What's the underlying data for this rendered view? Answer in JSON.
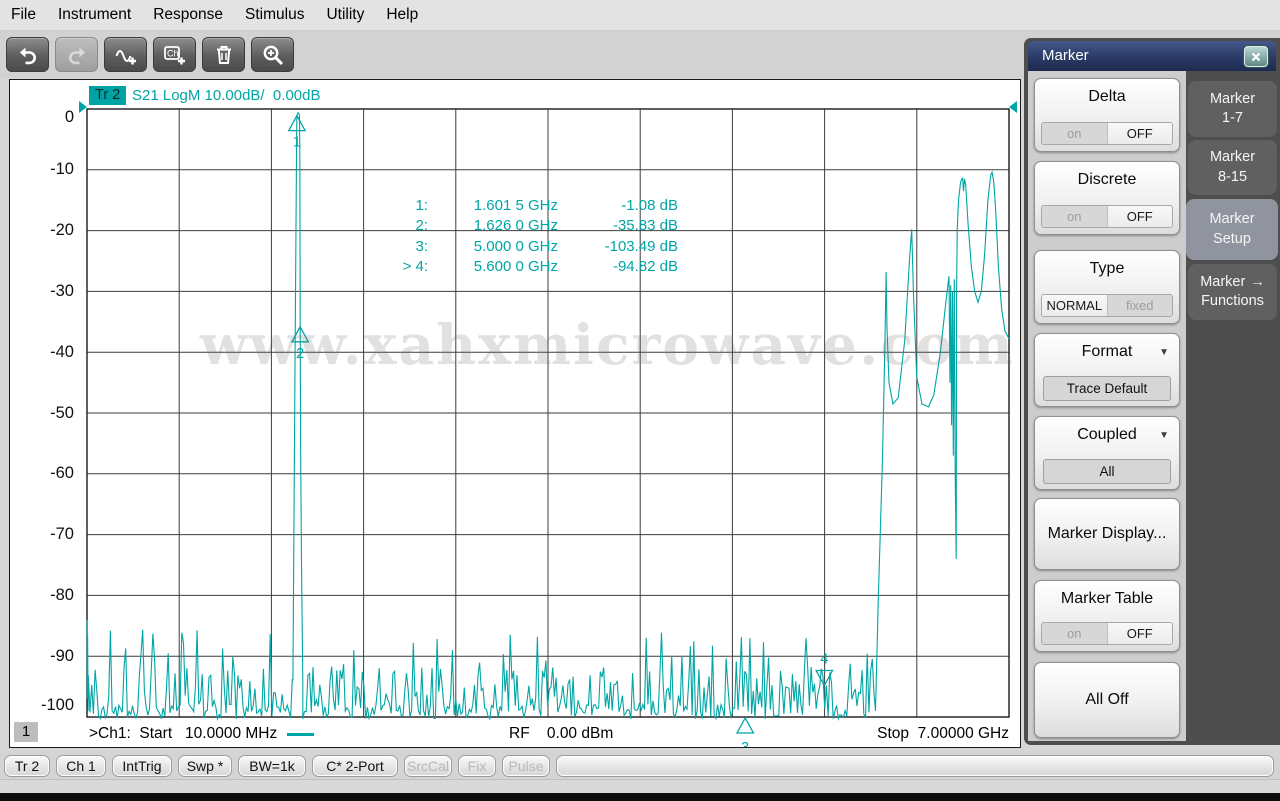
{
  "menu": {
    "items": [
      "File",
      "Instrument",
      "Response",
      "Stimulus",
      "Utility",
      "Help"
    ]
  },
  "toolbar": {
    "buttons": [
      {
        "name": "undo",
        "enabled": true
      },
      {
        "name": "redo",
        "enabled": false
      },
      {
        "name": "add-trace",
        "enabled": true
      },
      {
        "name": "add-channel",
        "enabled": true
      },
      {
        "name": "delete",
        "enabled": true
      },
      {
        "name": "zoom",
        "enabled": true
      }
    ]
  },
  "chart": {
    "trace_badge": "Tr 2",
    "trace_label": "S21 LogM 10.00dB/  0.00dB",
    "y_ticks": [
      "0",
      "-10",
      "-20",
      "-30",
      "-40",
      "-50",
      "-60",
      "-70",
      "-80",
      "-90",
      "-100"
    ],
    "markers_readout": [
      {
        "label": "1:",
        "freq": "1.601 5 GHz",
        "value": "-1.08 dB"
      },
      {
        "label": "2:",
        "freq": "1.626 0 GHz",
        "value": "-35.83 dB"
      },
      {
        "label": "3:",
        "freq": "5.000 0 GHz",
        "value": "-103.49 dB"
      },
      {
        "label": "> 4:",
        "freq": "5.600 0 GHz",
        "value": "-94.82 dB"
      }
    ],
    "footer": {
      "channel": "1",
      "start": ">Ch1:  Start   10.0000 MHz",
      "rf": "RF    0.00 dBm",
      "stop": "Stop  7.00000 GHz"
    },
    "watermark": "www.xahxmicrowave.com"
  },
  "chart_data": {
    "type": "line",
    "title": "S21 LogM 10.00dB/ 0.00dB",
    "x_unit": "GHz",
    "y_unit": "dB",
    "x_range": [
      0.01,
      7.0
    ],
    "y_range": [
      -100,
      0
    ],
    "y_per_div": 10,
    "grid_divisions": [
      10,
      10
    ],
    "markers": [
      {
        "n": 1,
        "ghz": 1.6015,
        "db": -1.08,
        "flip": false
      },
      {
        "n": 2,
        "ghz": 1.626,
        "db": -35.83,
        "flip": false
      },
      {
        "n": 3,
        "ghz": 5.0,
        "db": -103.49,
        "flip": false
      },
      {
        "n": 4,
        "ghz": 5.6,
        "db": -94.82,
        "flip": true,
        "selected": true
      }
    ],
    "anchors_left_edge": [
      [
        0.01,
        -84
      ],
      [
        0.012,
        -97
      ],
      [
        0.0145,
        -86.5
      ],
      [
        0.018,
        -99
      ]
    ],
    "anchors_spur": [
      [
        1.571,
        -94
      ],
      [
        1.5875,
        -40
      ],
      [
        1.5995,
        -3
      ],
      [
        1.6015,
        -1.08
      ],
      [
        1.61,
        -0.6
      ],
      [
        1.62,
        -0.9
      ],
      [
        1.6235,
        -6
      ],
      [
        1.626,
        -35.83
      ],
      [
        1.6295,
        -55
      ],
      [
        1.636,
        -75
      ],
      [
        1.646,
        -94
      ]
    ],
    "anchors_passband": [
      [
        5.988,
        -99
      ],
      [
        6.01,
        -80
      ],
      [
        6.04,
        -58
      ],
      [
        6.06,
        -38
      ],
      [
        6.068,
        -26.8
      ],
      [
        6.075,
        -36
      ],
      [
        6.09,
        -45
      ],
      [
        6.12,
        -48.5
      ],
      [
        6.16,
        -47.5
      ],
      [
        6.21,
        -38
      ],
      [
        6.245,
        -25
      ],
      [
        6.262,
        -19.8
      ],
      [
        6.275,
        -30
      ],
      [
        6.3,
        -44
      ],
      [
        6.34,
        -48.5
      ],
      [
        6.39,
        -49
      ],
      [
        6.43,
        -47
      ],
      [
        6.48,
        -40
      ],
      [
        6.52,
        -32
      ],
      [
        6.545,
        -27.5
      ],
      [
        6.553,
        -45
      ],
      [
        6.558,
        -29
      ],
      [
        6.565,
        -52
      ],
      [
        6.572,
        -30
      ],
      [
        6.578,
        -57
      ],
      [
        6.585,
        -28
      ],
      [
        6.592,
        -60
      ],
      [
        6.6,
        -74
      ],
      [
        6.603,
        -30
      ],
      [
        6.607,
        -20
      ],
      [
        6.617,
        -15
      ],
      [
        6.633,
        -12
      ],
      [
        6.648,
        -11.3
      ],
      [
        6.655,
        -13.5
      ],
      [
        6.663,
        -11.5
      ],
      [
        6.672,
        -12.5
      ],
      [
        6.69,
        -19
      ],
      [
        6.715,
        -26
      ],
      [
        6.74,
        -30
      ],
      [
        6.765,
        -31.8
      ],
      [
        6.79,
        -30
      ],
      [
        6.815,
        -24
      ],
      [
        6.84,
        -15
      ],
      [
        6.862,
        -10.8
      ],
      [
        6.872,
        -10.4
      ],
      [
        6.885,
        -12
      ],
      [
        6.9,
        -17
      ],
      [
        6.92,
        -26
      ],
      [
        6.945,
        -33
      ],
      [
        6.97,
        -36.5
      ],
      [
        7.0,
        -37.8
      ]
    ],
    "noise_floor": {
      "base_db": -100,
      "spike_max_db": -85,
      "regions_ghz": [
        [
          0.02,
          1.571
        ],
        [
          1.646,
          5.988
        ]
      ]
    }
  },
  "panel": {
    "title": "Marker",
    "buttons": [
      {
        "id": "delta",
        "label": "Delta",
        "toggle": {
          "options": [
            "on",
            "OFF"
          ],
          "selected": 1
        }
      },
      {
        "id": "discrete",
        "label": "Discrete",
        "toggle": {
          "options": [
            "on",
            "OFF"
          ],
          "selected": 1
        }
      },
      {
        "id": "type",
        "label": "Type",
        "toggle": {
          "options": [
            "NORMAL",
            "fixed"
          ],
          "selected": 0
        }
      },
      {
        "id": "format",
        "label": "Format",
        "dropdown": true,
        "sub_label": "Trace Default"
      },
      {
        "id": "coupled",
        "label": "Coupled",
        "dropdown": true,
        "sub_label": "All"
      },
      {
        "id": "marker-display",
        "label": "Marker Display..."
      },
      {
        "id": "marker-table",
        "label": "Marker Table",
        "toggle": {
          "options": [
            "on",
            "OFF"
          ],
          "selected": 1
        }
      },
      {
        "id": "all-off",
        "label": "All Off"
      }
    ],
    "tabs": [
      {
        "id": "marker-1-7",
        "lines": [
          "Marker",
          "1-7"
        ],
        "selected": false,
        "arrow": false
      },
      {
        "id": "marker-8-15",
        "lines": [
          "Marker",
          "8-15"
        ],
        "selected": false,
        "arrow": false
      },
      {
        "id": "marker-setup",
        "lines": [
          "Marker",
          "Setup"
        ],
        "selected": true,
        "arrow": false
      },
      {
        "id": "marker-functions",
        "lines": [
          "Marker",
          "Functions"
        ],
        "selected": false,
        "arrow": true
      }
    ]
  },
  "statusbar": {
    "buttons": [
      {
        "label": "Tr 2",
        "enabled": true
      },
      {
        "label": "Ch 1",
        "enabled": true
      },
      {
        "label": "IntTrig",
        "enabled": true
      },
      {
        "label": "Swp *",
        "enabled": true
      },
      {
        "label": "BW=1k",
        "enabled": true
      },
      {
        "label": "C* 2-Port",
        "enabled": true
      },
      {
        "label": "SrcCal",
        "enabled": false
      },
      {
        "label": "Fix",
        "enabled": false
      },
      {
        "label": "Pulse",
        "enabled": false
      },
      {
        "label": "",
        "enabled": true
      }
    ]
  },
  "colors": {
    "trace": "#00A5A5",
    "badge_bg": "#00A3A3",
    "grid": "#3d3d3d",
    "plot_border": "#1a1a1a",
    "panel_title_top": "#46588C",
    "panel_title_bottom": "#1F2B50",
    "tab_selected": "#8F949E"
  }
}
